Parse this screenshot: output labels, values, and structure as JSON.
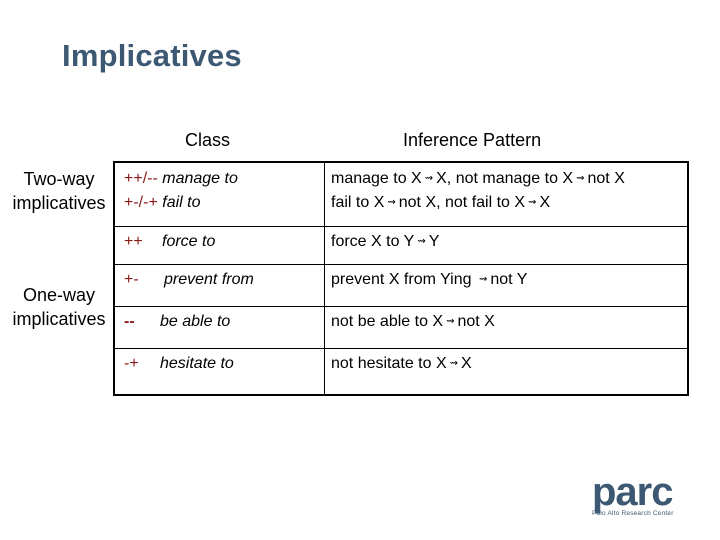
{
  "slide": {
    "title": "Implicatives",
    "column_headers": {
      "class": "Class",
      "inference": "Inference Pattern"
    },
    "row_groups": [
      {
        "label_line1": "Two-way",
        "label_line2": "implicatives"
      },
      {
        "label_line1": "One-way",
        "label_line2": "implicatives"
      }
    ],
    "rows": [
      {
        "class_lines": [
          {
            "sign": "++/--",
            "verb": "manage to"
          },
          {
            "sign": "+-/-+",
            "verb": "fail to"
          }
        ],
        "inference_lines": [
          {
            "a": "manage to X",
            "b": "X, not manage to X",
            "c": "not X"
          },
          {
            "a": "fail to X",
            "b": "not X, not fail to X",
            "c": "X"
          }
        ]
      },
      {
        "sign": "++",
        "verb": "force to",
        "inf_a": "force X to Y",
        "inf_b": "Y"
      },
      {
        "sign": "+-",
        "verb": "prevent from",
        "inf_a": "prevent X from Ying ",
        "inf_b": "not Y"
      },
      {
        "sign": "--",
        "verb": "be able to",
        "inf_a": "not be able to X",
        "inf_b": "not X"
      },
      {
        "sign": "-+",
        "verb": "hesitate to",
        "inf_a": "not hesitate to X",
        "inf_b": "X"
      }
    ],
    "arrow_glyph": "⇝",
    "logo": {
      "word": "parc",
      "subtitle": "Palo Alto Research Center"
    }
  }
}
